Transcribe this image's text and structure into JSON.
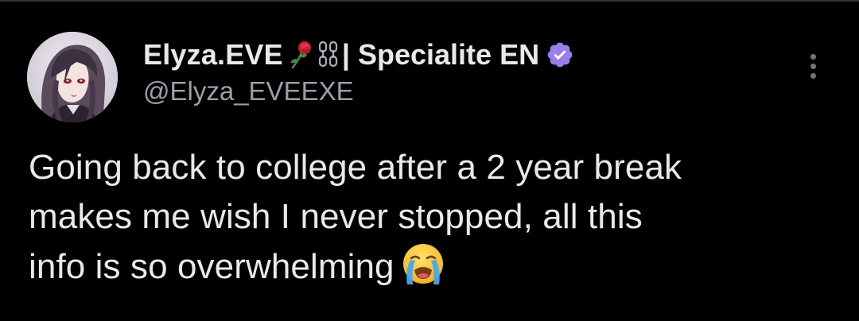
{
  "tweet": {
    "author": {
      "name": "Elyza.EVE",
      "name_suffix": "| Specialite EN",
      "handle": "@Elyza_EVEEXE",
      "verified": true,
      "verified_color": "#9b7ded",
      "name_decoration_icons": [
        "rose-icon",
        "chain-icon"
      ]
    },
    "text_lines": [
      "Going back to college after a 2 year break",
      "makes me wish I never stopped, all this",
      "info is so overwhelming"
    ],
    "trailing_emoji_icon": "loudly-crying-face-icon"
  },
  "colors": {
    "background": "#000000",
    "text_primary": "#e7e9ea",
    "text_secondary": "#9aa0a6",
    "divider": "#2f3336"
  }
}
